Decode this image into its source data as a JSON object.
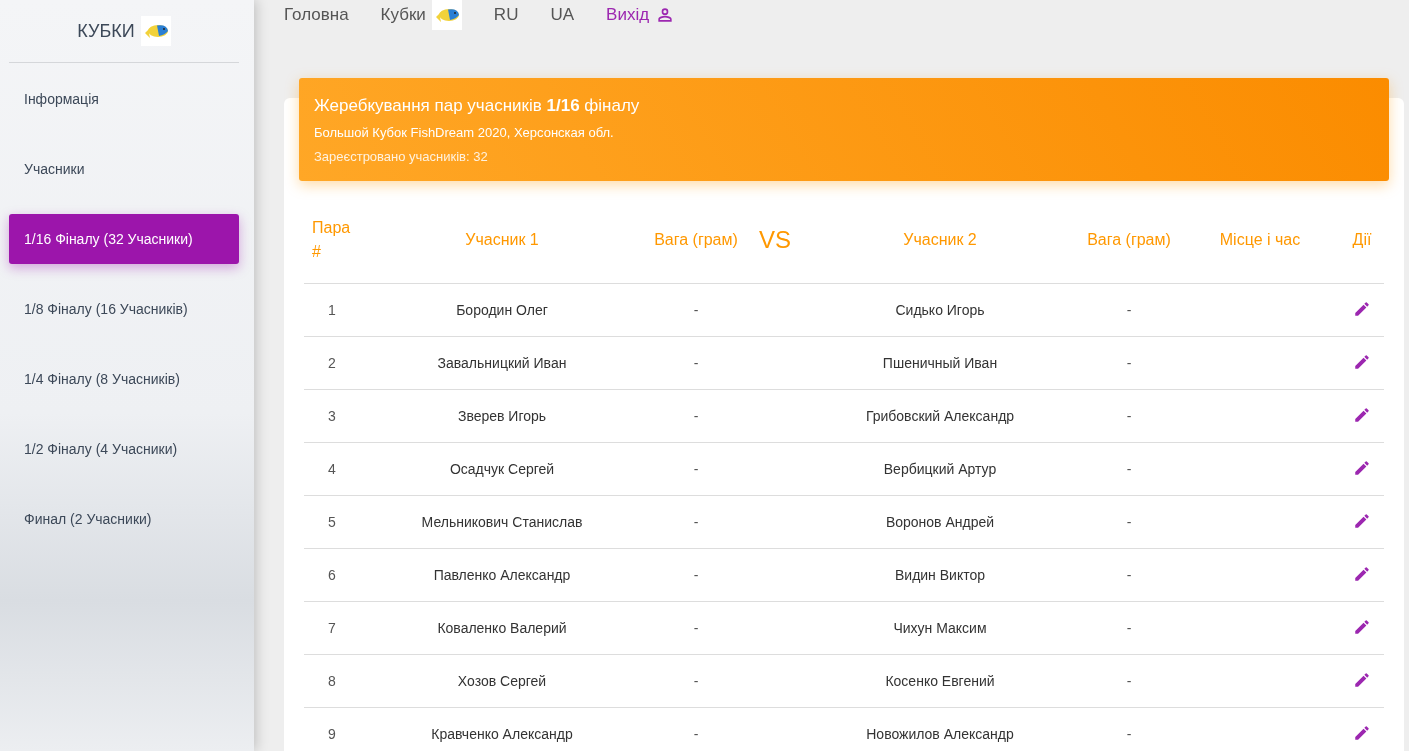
{
  "sidebar": {
    "brand": "КУБКИ",
    "items": [
      {
        "label": "Інформація",
        "selected": false
      },
      {
        "label": "Учасники",
        "selected": false
      },
      {
        "label": "1/16 Фіналу (32 Учасники)",
        "selected": true
      },
      {
        "label": "1/8 Фіналу (16 Учасників)",
        "selected": false
      },
      {
        "label": "1/4 Фіналу (8 Учасників)",
        "selected": false
      },
      {
        "label": "1/2 Фіналу (4 Учасники)",
        "selected": false
      },
      {
        "label": "Финал (2 Учасники)",
        "selected": false
      }
    ]
  },
  "nav": {
    "items": [
      {
        "label": "Головна",
        "kind": "text"
      },
      {
        "label": "Кубки",
        "kind": "logo"
      },
      {
        "label": "RU",
        "kind": "text"
      },
      {
        "label": "UA",
        "kind": "text"
      },
      {
        "label": "Вихід",
        "kind": "user"
      }
    ]
  },
  "card": {
    "title": "Жеребкування пар учасників **1/16** фіналу",
    "subtitle": "Большой Кубок FishDream 2020, Херсонская обл.",
    "count": "Зареєстровано учасників: 32"
  },
  "table": {
    "columns": [
      "Пара #",
      "Учасник 1",
      "Вага (грам)",
      "VS",
      "Учасник 2",
      "Вага (грам)",
      "Місце і час",
      "Дії"
    ],
    "rows": [
      {
        "pair": "1",
        "p1": "Бородин Олег",
        "w1": "-",
        "p2": "Сидько Игорь",
        "w2": "-"
      },
      {
        "pair": "2",
        "p1": "Завальницкий Иван",
        "w1": "-",
        "p2": "Пшеничный Иван",
        "w2": "-"
      },
      {
        "pair": "3",
        "p1": "Зверев Игорь",
        "w1": "-",
        "p2": "Грибовский Александр",
        "w2": "-"
      },
      {
        "pair": "4",
        "p1": "Осадчук Сергей",
        "w1": "-",
        "p2": "Вербицкий Артур",
        "w2": "-"
      },
      {
        "pair": "5",
        "p1": "Мельникович Станислав",
        "w1": "-",
        "p2": "Воронов Андрей",
        "w2": "-"
      },
      {
        "pair": "6",
        "p1": "Павленко Александр",
        "w1": "-",
        "p2": "Видин Виктор",
        "w2": "-"
      },
      {
        "pair": "7",
        "p1": "Коваленко Валерий",
        "w1": "-",
        "p2": "Чихун Максим",
        "w2": "-"
      },
      {
        "pair": "8",
        "p1": "Хозов Сергей",
        "w1": "-",
        "p2": "Косенко Евгений",
        "w2": "-"
      },
      {
        "pair": "9",
        "p1": "Кравченко Александр",
        "w1": "-",
        "p2": "Новожилов Александр",
        "w2": "-"
      }
    ]
  }
}
